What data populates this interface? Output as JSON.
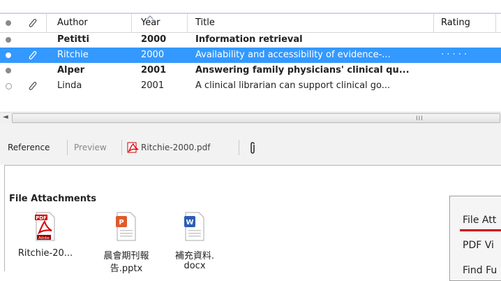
{
  "grid": {
    "headers": {
      "attach_icon": "paperclip-icon",
      "author": "Author",
      "year": "Year",
      "title": "Title",
      "rating": "Rating",
      "sort_indicator": "^"
    },
    "rows": [
      {
        "author": "Petitti",
        "year": "2000",
        "title": "Information retrieval",
        "rating": "",
        "bold": true,
        "selected": false,
        "dot": "filled",
        "attachment": false
      },
      {
        "author": "Ritchie",
        "year": "2000",
        "title": "Availability and accessibility of evidence-...",
        "rating": "·  ·  ·  ·  ·",
        "bold": false,
        "selected": true,
        "dot": "filled",
        "attachment": true
      },
      {
        "author": "Alper",
        "year": "2001",
        "title": "Answering family physicians' clinical qu...",
        "rating": "",
        "bold": true,
        "selected": false,
        "dot": "filled",
        "attachment": false
      },
      {
        "author": "Linda",
        "year": "2001",
        "title": "A clinical librarian can support clinical go...",
        "rating": "",
        "bold": false,
        "selected": false,
        "dot": "hollow",
        "attachment": true
      }
    ],
    "scroll_grip": "III",
    "scroll_left": "◄"
  },
  "tabs": {
    "reference": "Reference",
    "preview": "Preview",
    "pdf_file": "Ritchie-2000.pdf",
    "attach_icon": "paperclip-icon"
  },
  "attachments": {
    "title": "File Attachments",
    "files": [
      {
        "name": "Ritchie-20...",
        "name2": "",
        "icon": "pdf-icon",
        "badge": "PDF",
        "badge2": "Adobe"
      },
      {
        "name": "晨會期刊報",
        "name2": "告.pptx",
        "icon": "pptx-icon",
        "badge": "P",
        "badge2": ""
      },
      {
        "name": "補充資料.",
        "name2": "docx",
        "icon": "docx-icon",
        "badge": "W",
        "badge2": ""
      }
    ]
  },
  "context_menu": {
    "items": [
      "File Att",
      "PDF Vi",
      "Find Fu"
    ]
  },
  "colors": {
    "selection": "#3399ff",
    "accent_red": "#d00000"
  }
}
